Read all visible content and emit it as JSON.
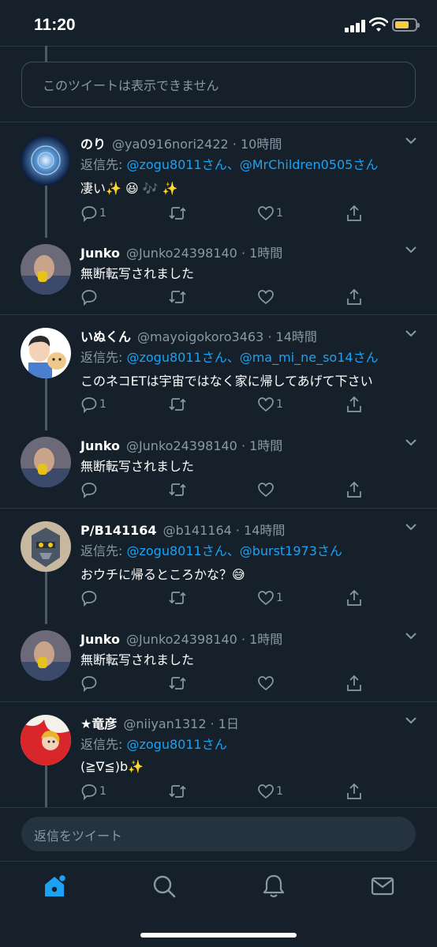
{
  "status_bar": {
    "time": "11:20"
  },
  "unavailable_text": "このツイートは表示できません",
  "tweets": [
    {
      "name": "のり",
      "handle": "@ya0916nori2422",
      "time": "10時間",
      "reply_prefix": "返信先: ",
      "mentions": "@zogu8011さん、@MrChildren0505さん",
      "text": "凄い✨ 😆 🎶 ✨",
      "reply_count": "1",
      "retweet_count": "",
      "like_count": "1"
    },
    {
      "name": "Junko",
      "handle": "@Junko24398140",
      "time": "1時間",
      "text": "無断転写されました",
      "reply_count": "",
      "retweet_count": "",
      "like_count": ""
    },
    {
      "name": "いぬくん",
      "handle": "@mayoigokoro3463",
      "time": "14時間",
      "reply_prefix": "返信先: ",
      "mentions": "@zogu8011さん、@ma_mi_ne_so14さん",
      "text": "このネコETは宇宙ではなく家に帰してあげて下さい",
      "reply_count": "1",
      "retweet_count": "",
      "like_count": "1"
    },
    {
      "name": "Junko",
      "handle": "@Junko24398140",
      "time": "1時間",
      "text": "無断転写されました",
      "reply_count": "",
      "retweet_count": "",
      "like_count": ""
    },
    {
      "name": "P/B141164",
      "handle": "@b141164",
      "time": "14時間",
      "reply_prefix": "返信先: ",
      "mentions": "@zogu8011さん、@burst1973さん",
      "text": "おウチに帰るところかな？😅",
      "reply_count": "",
      "retweet_count": "",
      "like_count": "1"
    },
    {
      "name": "Junko",
      "handle": "@Junko24398140",
      "time": "1時間",
      "text": "無断転写されました",
      "reply_count": "",
      "retweet_count": "",
      "like_count": ""
    },
    {
      "name": "★竜彦",
      "handle": "@niiyan1312",
      "time": "1日",
      "reply_prefix": "返信先: ",
      "mentions": "@zogu8011さん",
      "text": "(≧∇≦)b✨",
      "reply_count": "1",
      "retweet_count": "",
      "like_count": "1"
    }
  ],
  "reply_bar": {
    "placeholder": "返信をツイート"
  },
  "tabs": {
    "home": "home-icon",
    "search": "search-icon",
    "notifications": "bell-icon",
    "messages": "mail-icon"
  },
  "colors": {
    "background": "#15202b",
    "accent": "#1da1f2",
    "muted": "#8899a6"
  }
}
